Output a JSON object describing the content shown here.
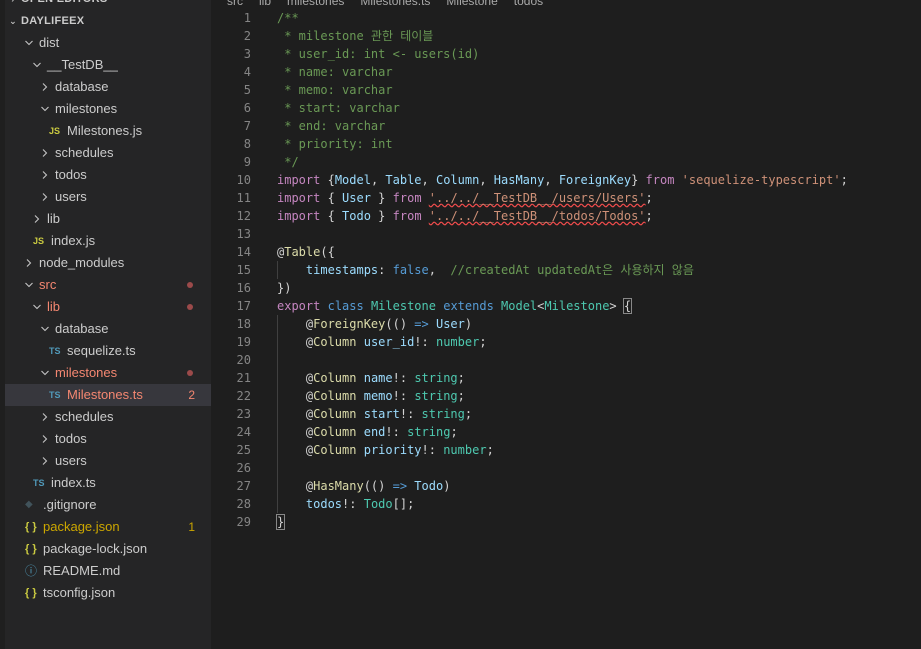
{
  "breadcrumb": [
    "src",
    "lib",
    "milestones",
    "Milestones.ts",
    "Milestone",
    "todos"
  ],
  "sidebar": {
    "open_editors": "OPEN EDITORS",
    "project": "DAYLIFEEX",
    "items": [
      {
        "label": "dist",
        "type": "folder",
        "open": true,
        "depth": 1
      },
      {
        "label": "__TestDB__",
        "type": "folder",
        "open": true,
        "depth": 2
      },
      {
        "label": "database",
        "type": "folder",
        "open": false,
        "depth": 3
      },
      {
        "label": "milestones",
        "type": "folder",
        "open": true,
        "depth": 3
      },
      {
        "label": "Milestones.js",
        "type": "js",
        "depth": 4
      },
      {
        "label": "schedules",
        "type": "folder",
        "open": false,
        "depth": 3
      },
      {
        "label": "todos",
        "type": "folder",
        "open": false,
        "depth": 3
      },
      {
        "label": "users",
        "type": "folder",
        "open": false,
        "depth": 3
      },
      {
        "label": "lib",
        "type": "folder",
        "open": false,
        "depth": 2
      },
      {
        "label": "index.js",
        "type": "js",
        "depth": 2
      },
      {
        "label": "node_modules",
        "type": "folder",
        "open": false,
        "depth": 1
      },
      {
        "label": "src",
        "type": "folder",
        "open": true,
        "depth": 1,
        "modified": true
      },
      {
        "label": "lib",
        "type": "folder",
        "open": true,
        "depth": 2,
        "modified": true
      },
      {
        "label": "database",
        "type": "folder",
        "open": true,
        "depth": 3
      },
      {
        "label": "sequelize.ts",
        "type": "ts",
        "depth": 4
      },
      {
        "label": "milestones",
        "type": "folder",
        "open": true,
        "depth": 3,
        "modified": true
      },
      {
        "label": "Milestones.ts",
        "type": "ts",
        "depth": 4,
        "modified": true,
        "badge": "2",
        "selected": true
      },
      {
        "label": "schedules",
        "type": "folder",
        "open": false,
        "depth": 3
      },
      {
        "label": "todos",
        "type": "folder",
        "open": false,
        "depth": 3
      },
      {
        "label": "users",
        "type": "folder",
        "open": false,
        "depth": 3
      },
      {
        "label": "index.ts",
        "type": "ts",
        "depth": 2
      },
      {
        "label": ".gitignore",
        "type": "git",
        "depth": 1
      },
      {
        "label": "package.json",
        "type": "json",
        "depth": 1,
        "warning": true,
        "badge": "1"
      },
      {
        "label": "package-lock.json",
        "type": "json",
        "depth": 1
      },
      {
        "label": "README.md",
        "type": "info",
        "depth": 1
      },
      {
        "label": "tsconfig.json",
        "type": "json",
        "depth": 1
      }
    ]
  },
  "icons": {
    "ts": "TS",
    "js": "JS",
    "json": "{ }",
    "info": "ⓘ",
    "git": "◆"
  },
  "editor": {
    "lines": [
      {
        "n": "1",
        "indent": 0,
        "tokens": [
          [
            "c",
            "/**"
          ]
        ]
      },
      {
        "n": "2",
        "indent": 0,
        "tokens": [
          [
            "c",
            " * milestone 관한 테이블"
          ]
        ]
      },
      {
        "n": "3",
        "indent": 0,
        "tokens": [
          [
            "c",
            " * user_id: int <- users(id)"
          ]
        ]
      },
      {
        "n": "4",
        "indent": 0,
        "tokens": [
          [
            "c",
            " * name: varchar"
          ]
        ]
      },
      {
        "n": "5",
        "indent": 0,
        "tokens": [
          [
            "c",
            " * memo: varchar"
          ]
        ]
      },
      {
        "n": "6",
        "indent": 0,
        "tokens": [
          [
            "c",
            " * start: varchar"
          ]
        ]
      },
      {
        "n": "7",
        "indent": 0,
        "tokens": [
          [
            "c",
            " * end: varchar"
          ]
        ]
      },
      {
        "n": "8",
        "indent": 0,
        "tokens": [
          [
            "c",
            " * priority: int"
          ]
        ]
      },
      {
        "n": "9",
        "indent": 0,
        "tokens": [
          [
            "c",
            " */"
          ]
        ]
      },
      {
        "n": "10",
        "indent": 0,
        "tokens": [
          [
            "kp",
            "import"
          ],
          [
            "p",
            " {"
          ],
          [
            "v",
            "Model"
          ],
          [
            "p",
            ", "
          ],
          [
            "v",
            "Table"
          ],
          [
            "p",
            ", "
          ],
          [
            "v",
            "Column"
          ],
          [
            "p",
            ", "
          ],
          [
            "v",
            "HasMany"
          ],
          [
            "p",
            ", "
          ],
          [
            "v",
            "ForeignKey"
          ],
          [
            "p",
            "} "
          ],
          [
            "kp",
            "from"
          ],
          [
            "p",
            " "
          ],
          [
            "s",
            "'sequelize-typescript'"
          ],
          [
            "p",
            ";"
          ]
        ]
      },
      {
        "n": "11",
        "indent": 0,
        "tokens": [
          [
            "kp",
            "import"
          ],
          [
            "p",
            " { "
          ],
          [
            "v",
            "User"
          ],
          [
            "p",
            " } "
          ],
          [
            "kp",
            "from"
          ],
          [
            "p",
            " "
          ],
          [
            "s err",
            "'../../__TestDB__/users/Users'"
          ],
          [
            "p",
            ";"
          ]
        ]
      },
      {
        "n": "12",
        "indent": 0,
        "tokens": [
          [
            "kp",
            "import"
          ],
          [
            "p",
            " { "
          ],
          [
            "v",
            "Todo"
          ],
          [
            "p",
            " } "
          ],
          [
            "kp",
            "from"
          ],
          [
            "p",
            " "
          ],
          [
            "s err",
            "'../../__TestDB__/todos/Todos'"
          ],
          [
            "p",
            ";"
          ]
        ]
      },
      {
        "n": "13",
        "indent": 0,
        "tokens": []
      },
      {
        "n": "14",
        "indent": 0,
        "tokens": [
          [
            "p",
            "@"
          ],
          [
            "f",
            "Table"
          ],
          [
            "p",
            "({"
          ]
        ]
      },
      {
        "n": "15",
        "indent": 1,
        "tokens": [
          [
            "p",
            "    "
          ],
          [
            "v",
            "timestamps"
          ],
          [
            "p",
            ": "
          ],
          [
            "k",
            "false"
          ],
          [
            "p",
            ",  "
          ],
          [
            "c",
            "//createdAt updatedAt은 사용하지 않음"
          ]
        ]
      },
      {
        "n": "16",
        "indent": 0,
        "tokens": [
          [
            "p",
            "})"
          ]
        ]
      },
      {
        "n": "17",
        "indent": 0,
        "tokens": [
          [
            "kp",
            "export"
          ],
          [
            "p",
            " "
          ],
          [
            "k",
            "class"
          ],
          [
            "p",
            " "
          ],
          [
            "t",
            "Milestone"
          ],
          [
            "p",
            " "
          ],
          [
            "k",
            "extends"
          ],
          [
            "p",
            " "
          ],
          [
            "t",
            "Model"
          ],
          [
            "p",
            "<"
          ],
          [
            "t",
            "Milestone"
          ],
          [
            "p",
            "> "
          ],
          [
            "p brk",
            "{"
          ]
        ]
      },
      {
        "n": "18",
        "indent": 1,
        "tokens": [
          [
            "p",
            "    @"
          ],
          [
            "f",
            "ForeignKey"
          ],
          [
            "p",
            "(() "
          ],
          [
            "k",
            "=>"
          ],
          [
            "p",
            " "
          ],
          [
            "v",
            "User"
          ],
          [
            "p",
            ")"
          ]
        ]
      },
      {
        "n": "19",
        "indent": 1,
        "tokens": [
          [
            "p",
            "    @"
          ],
          [
            "f",
            "Column"
          ],
          [
            "p",
            " "
          ],
          [
            "v",
            "user_id"
          ],
          [
            "p",
            "!: "
          ],
          [
            "t",
            "number"
          ],
          [
            "p",
            ";"
          ]
        ]
      },
      {
        "n": "20",
        "indent": 1,
        "tokens": []
      },
      {
        "n": "21",
        "indent": 1,
        "tokens": [
          [
            "p",
            "    @"
          ],
          [
            "f",
            "Column"
          ],
          [
            "p",
            " "
          ],
          [
            "v",
            "name"
          ],
          [
            "p",
            "!: "
          ],
          [
            "t",
            "string"
          ],
          [
            "p",
            ";"
          ]
        ]
      },
      {
        "n": "22",
        "indent": 1,
        "tokens": [
          [
            "p",
            "    @"
          ],
          [
            "f",
            "Column"
          ],
          [
            "p",
            " "
          ],
          [
            "v",
            "memo"
          ],
          [
            "p",
            "!: "
          ],
          [
            "t",
            "string"
          ],
          [
            "p",
            ";"
          ]
        ]
      },
      {
        "n": "23",
        "indent": 1,
        "tokens": [
          [
            "p",
            "    @"
          ],
          [
            "f",
            "Column"
          ],
          [
            "p",
            " "
          ],
          [
            "v",
            "start"
          ],
          [
            "p",
            "!: "
          ],
          [
            "t",
            "string"
          ],
          [
            "p",
            ";"
          ]
        ]
      },
      {
        "n": "24",
        "indent": 1,
        "tokens": [
          [
            "p",
            "    @"
          ],
          [
            "f",
            "Column"
          ],
          [
            "p",
            " "
          ],
          [
            "v",
            "end"
          ],
          [
            "p",
            "!: "
          ],
          [
            "t",
            "string"
          ],
          [
            "p",
            ";"
          ]
        ]
      },
      {
        "n": "25",
        "indent": 1,
        "tokens": [
          [
            "p",
            "    @"
          ],
          [
            "f",
            "Column"
          ],
          [
            "p",
            " "
          ],
          [
            "v",
            "priority"
          ],
          [
            "p",
            "!: "
          ],
          [
            "t",
            "number"
          ],
          [
            "p",
            ";"
          ]
        ]
      },
      {
        "n": "26",
        "indent": 1,
        "tokens": []
      },
      {
        "n": "27",
        "indent": 1,
        "tokens": [
          [
            "p",
            "    @"
          ],
          [
            "f",
            "HasMany"
          ],
          [
            "p",
            "(() "
          ],
          [
            "k",
            "=>"
          ],
          [
            "p",
            " "
          ],
          [
            "v",
            "Todo"
          ],
          [
            "p",
            ")"
          ]
        ]
      },
      {
        "n": "28",
        "indent": 1,
        "tokens": [
          [
            "p",
            "    "
          ],
          [
            "v",
            "todos"
          ],
          [
            "p",
            "!: "
          ],
          [
            "t",
            "Todo"
          ],
          [
            "p",
            "[];"
          ]
        ]
      },
      {
        "n": "29",
        "indent": 0,
        "tokens": [
          [
            "p brk",
            "}"
          ]
        ]
      }
    ]
  }
}
